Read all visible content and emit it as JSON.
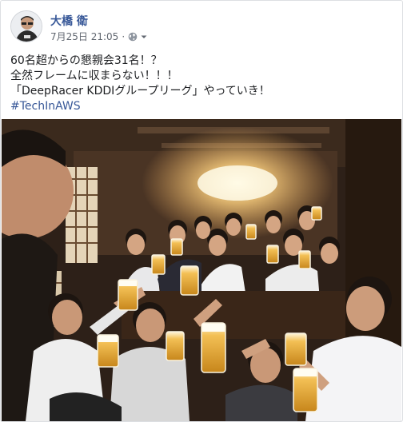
{
  "post": {
    "author": "大橋 衛",
    "timestamp": "7月25日 21:05",
    "separator": "·",
    "privacy_icon": "globe-icon",
    "menu_icon": "caret-down-icon",
    "lines": [
      "60名超からの懇親会31名！？",
      "全然フレームに収まらない！！！",
      "「DeepRacer KDDIグループリーグ」やっていき！"
    ],
    "hashtag": "#TechInAWS"
  },
  "colors": {
    "link": "#385898",
    "text": "#1c1e21",
    "meta": "#616770",
    "border": "#dddfe2"
  }
}
